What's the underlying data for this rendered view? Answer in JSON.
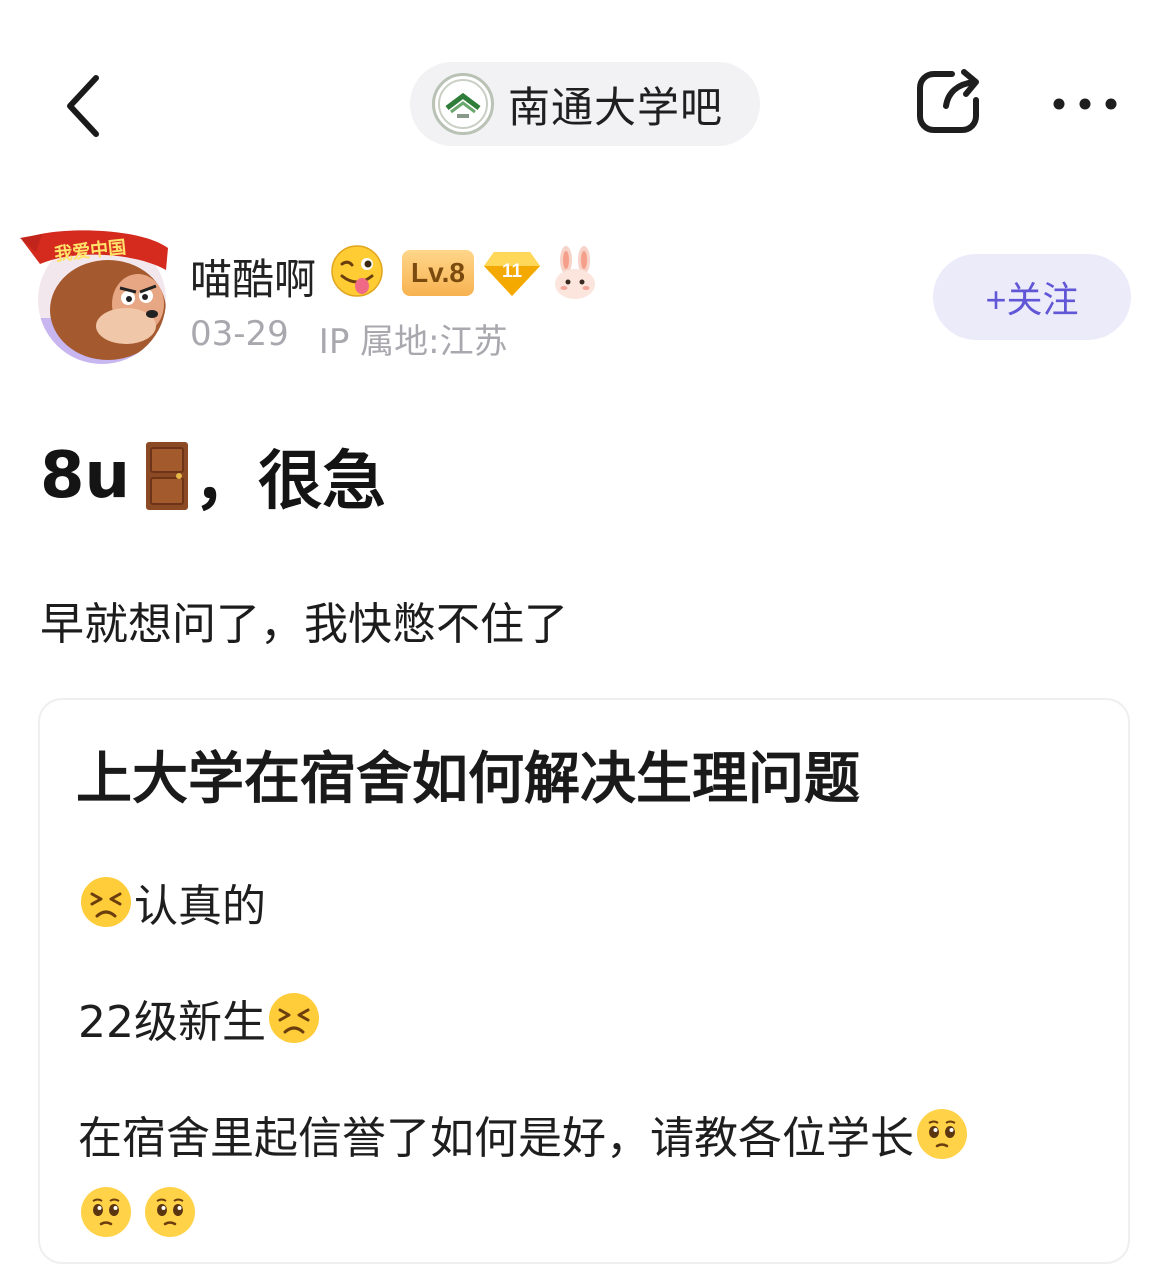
{
  "nav": {
    "forum_name": "南通大学吧",
    "icons": [
      "back-icon",
      "forum-logo",
      "share-icon",
      "more-icon"
    ]
  },
  "author": {
    "name": "喵酷啊",
    "level": "Lv.8",
    "gem_level": "11",
    "avatar_text": "我爱中国",
    "date": "03-29",
    "ip_location": "IP 属地:江苏",
    "follow_label": "+关注"
  },
  "post": {
    "title_prefix": "8u",
    "title_suffix": "，很急",
    "body": "早就想问了，我快憋不住了"
  },
  "card": {
    "heading": "上大学在宿舍如何解决生理问题",
    "line1": "认真的",
    "line2": "22级新生",
    "line3": "在宿舍里起信誉了如何是好，请教各位学长"
  },
  "colors": {
    "follow_bg": "#ecebfa",
    "follow_text": "#6056d6",
    "level_badge": "#f7b250",
    "meta_text": "#a8a8ae"
  }
}
